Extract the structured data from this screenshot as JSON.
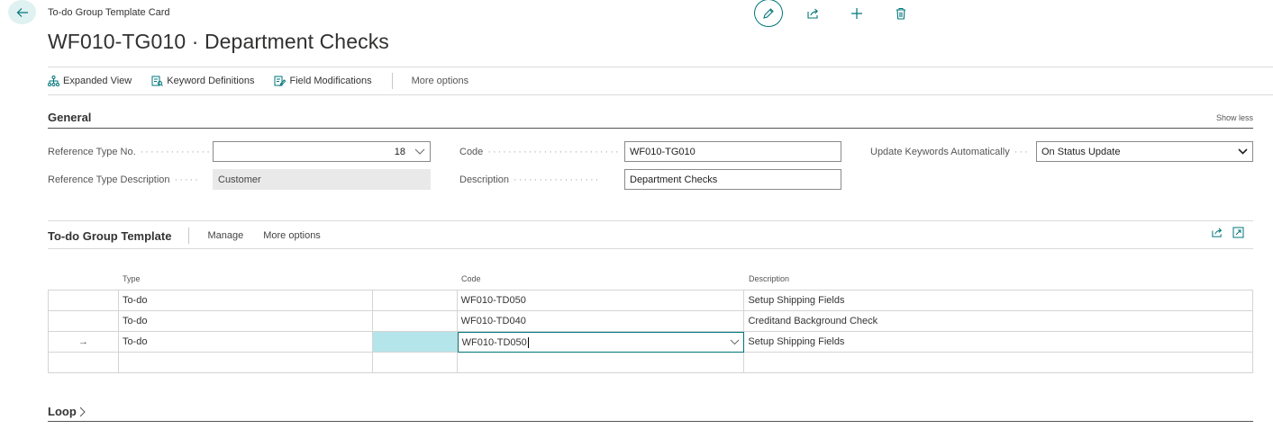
{
  "header": {
    "caption": "To-do Group Template Card",
    "title": "WF010-TG010 · Department Checks"
  },
  "actions": {
    "expanded_view": "Expanded View",
    "keyword_definitions": "Keyword Definitions",
    "field_modifications": "Field Modifications",
    "more_options": "More options"
  },
  "general": {
    "title": "General",
    "show_less": "Show less",
    "reference_type_no": {
      "label": "Reference Type No.",
      "value": "18"
    },
    "reference_type_description": {
      "label": "Reference Type Description",
      "value": "Customer"
    },
    "code": {
      "label": "Code",
      "value": "WF010-TG010"
    },
    "description": {
      "label": "Description",
      "value": "Department Checks"
    },
    "update_keywords": {
      "label": "Update Keywords Automatically",
      "value": "On Status Update"
    }
  },
  "part": {
    "title": "To-do Group Template",
    "manage": "Manage",
    "more_options": "More options",
    "columns": {
      "type": "Type",
      "code": "Code",
      "description": "Description"
    },
    "rows": [
      {
        "indicator": "",
        "type": "To-do",
        "code": "WF010-TD050",
        "description": "Setup Shipping Fields"
      },
      {
        "indicator": "",
        "type": "To-do",
        "code": "WF010-TD040",
        "description": "Creditand Background Check"
      },
      {
        "indicator": "→",
        "type": "To-do",
        "code": "WF010-TD050",
        "description": "Setup Shipping Fields"
      },
      {
        "indicator": "",
        "type": "",
        "code": "",
        "description": ""
      }
    ]
  },
  "loop": {
    "title": "Loop"
  },
  "colors": {
    "accent": "#00767b",
    "active_cell": "#b4e5ea"
  }
}
